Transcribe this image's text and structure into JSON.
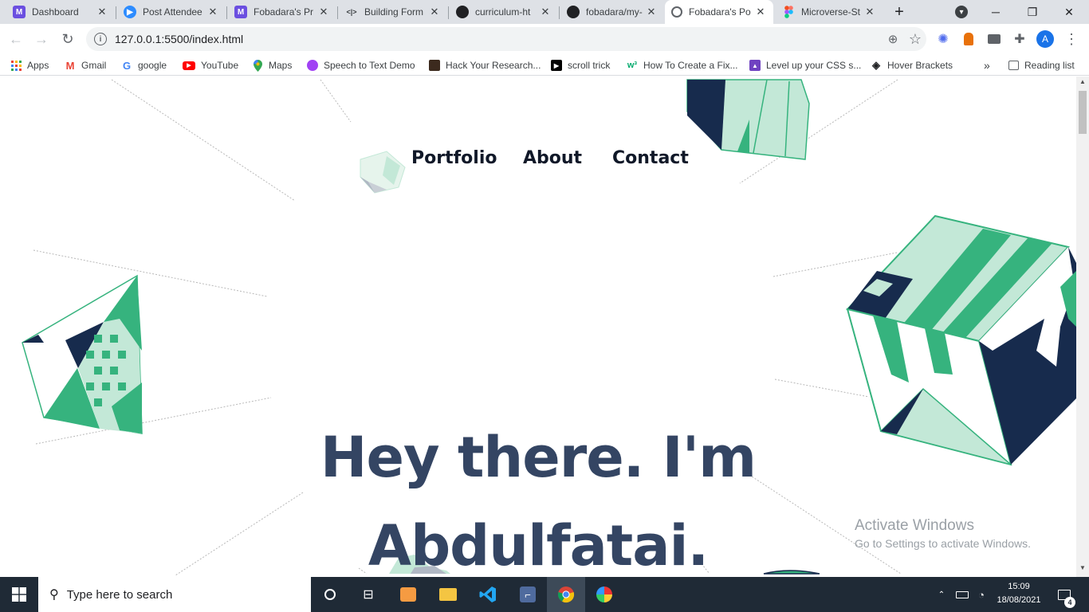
{
  "tabs": [
    {
      "title": "Dashboard",
      "favicon_color": "#6b4fe0",
      "favicon_glyph": "M",
      "active": false
    },
    {
      "title": "Post Attendee",
      "favicon_color": "#2d8cff",
      "favicon_glyph": "▶",
      "active": false
    },
    {
      "title": "Fobadara's Pr",
      "favicon_color": "#6b4fe0",
      "favicon_glyph": "M",
      "active": false
    },
    {
      "title": "Building Form",
      "favicon_color": "#dee1e6",
      "favicon_glyph": "<|>",
      "active": false
    },
    {
      "title": "curriculum-ht",
      "favicon_color": "#202124",
      "favicon_glyph": "●",
      "active": false
    },
    {
      "title": "fobadara/my-",
      "favicon_color": "#202124",
      "favicon_glyph": "●",
      "active": false
    },
    {
      "title": "Fobadara's Po",
      "favicon_color": "#5f6368",
      "favicon_glyph": "◎",
      "active": true
    },
    {
      "title": "Microverse-St",
      "favicon_color": "#f24e1e",
      "favicon_glyph": "F",
      "active": false
    }
  ],
  "new_tab_label": "+",
  "window_controls": {
    "minimize": "─",
    "restore": "❐",
    "close": "✕",
    "profile_menu": "▾"
  },
  "toolbar": {
    "back": "←",
    "forward": "→",
    "reload": "↻",
    "url": "127.0.0.1:5500/index.html",
    "info_glyph": "i",
    "zoom_glyph": "⊕",
    "star_glyph": "☆",
    "profile_initial": "A",
    "menu_glyph": "⋮"
  },
  "bookmarks": [
    {
      "label": "Apps",
      "icon": "apps-grid-icon",
      "color": "#4285f4"
    },
    {
      "label": "Gmail",
      "icon": "gmail-icon",
      "color": "#ea4335"
    },
    {
      "label": "google",
      "icon": "google-icon",
      "color": "#4285f4"
    },
    {
      "label": "YouTube",
      "icon": "youtube-icon",
      "color": "#ff0000"
    },
    {
      "label": "Maps",
      "icon": "maps-pin-icon",
      "color": "#34a853"
    },
    {
      "label": "Speech to Text Demo",
      "icon": "speech-icon",
      "color": "#a142f4"
    },
    {
      "label": "Hack Your Research...",
      "icon": "research-icon",
      "color": "#3c2a1e"
    },
    {
      "label": "scroll trick",
      "icon": "scroll-icon",
      "color": "#000000"
    },
    {
      "label": "How To Create a Fix...",
      "icon": "w3-icon",
      "color": "#04aa6d"
    },
    {
      "label": "Level up your CSS s...",
      "icon": "rocket-icon",
      "color": "#6f42c1"
    },
    {
      "label": "Hover Brackets",
      "icon": "codepen-icon",
      "color": "#202124"
    }
  ],
  "bookmarks_overflow": "»",
  "reading_list": "Reading list",
  "page": {
    "nav_links": [
      "Portfolio",
      "About",
      "Contact"
    ],
    "hero_line1": "Hey there. I'm",
    "hero_line2": "Abdulfatai.",
    "activate_title": "Activate Windows",
    "activate_sub": "Go to Settings to activate Windows."
  },
  "colors": {
    "navy": "#172b4d",
    "green": "#36b37e",
    "mint": "#c3e8d7",
    "hero": "#344563"
  },
  "taskbar": {
    "search_placeholder": "Type here to search",
    "time": "15:09",
    "date": "18/08/2021",
    "notification_count": "4"
  }
}
